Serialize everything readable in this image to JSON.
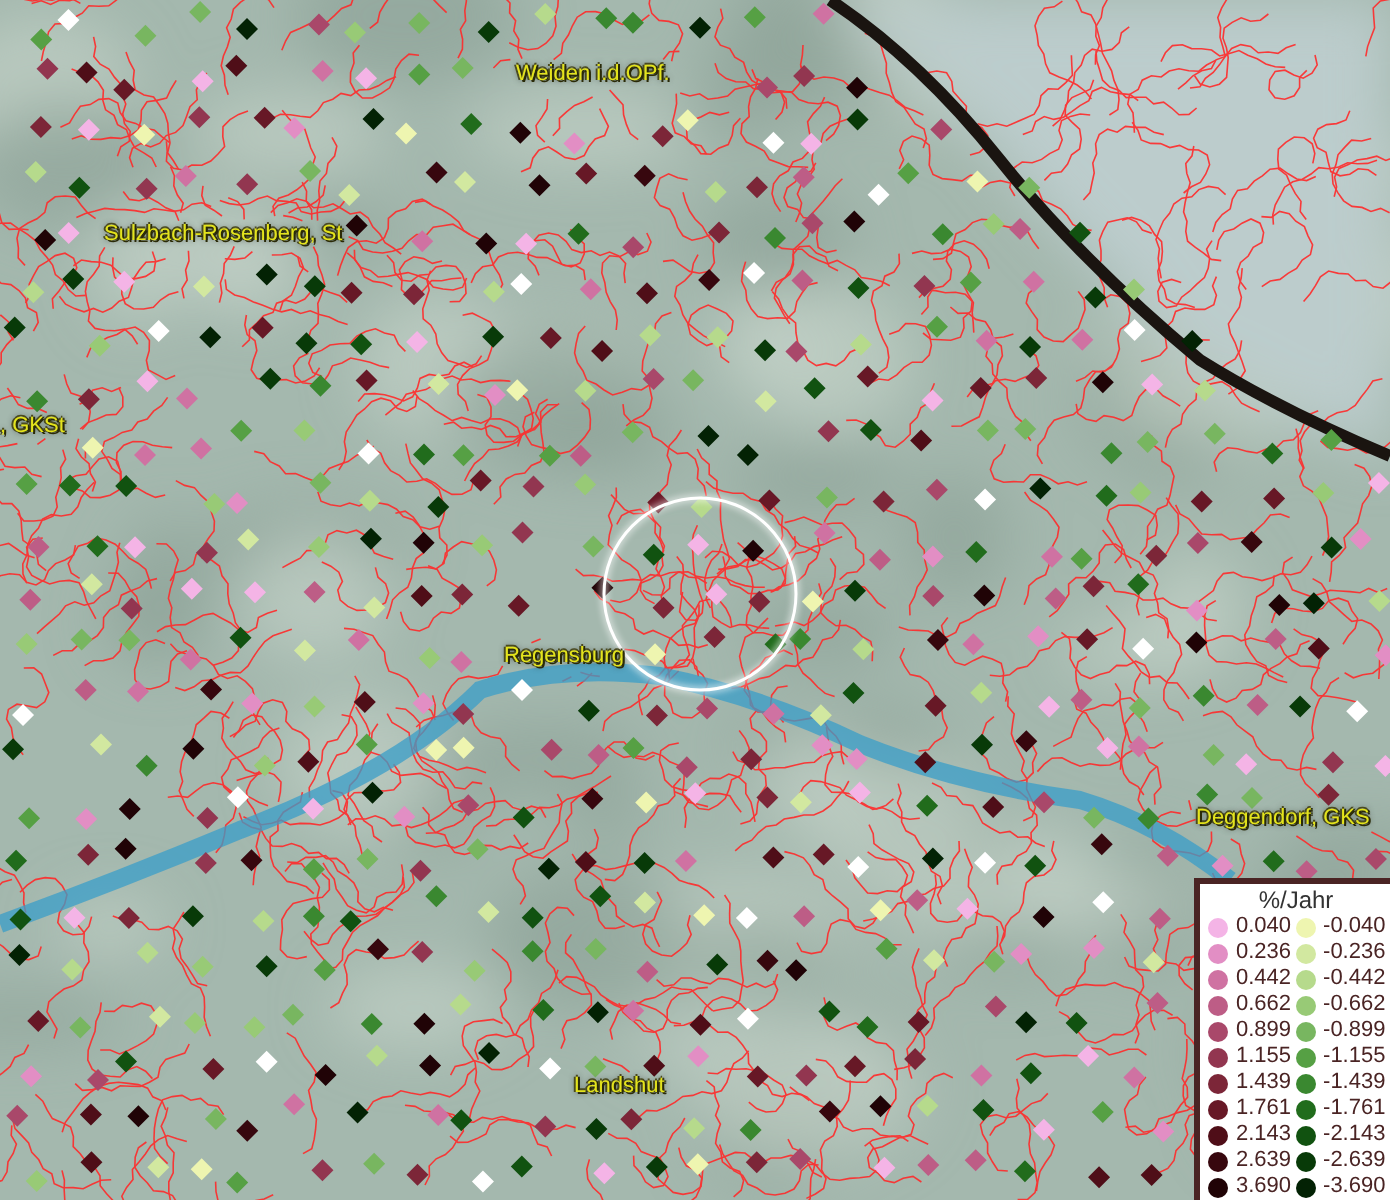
{
  "map": {
    "places": [
      {
        "name": "Weiden i.d.OPf."
      },
      {
        "name": "Sulzbach-Rosenberg, St"
      },
      {
        "name": ", GKSt"
      },
      {
        "name": "Regensburg"
      },
      {
        "name": "Deggendorf, GKS"
      },
      {
        "name": "Landshut"
      }
    ]
  },
  "legend": {
    "title": "%/Jahr",
    "positive": [
      {
        "label": "0.040",
        "color": "#f4b4e6"
      },
      {
        "label": "0.236",
        "color": "#e28ec4"
      },
      {
        "label": "0.442",
        "color": "#cf72a2"
      },
      {
        "label": "0.662",
        "color": "#bd5d86"
      },
      {
        "label": "0.899",
        "color": "#a9486a"
      },
      {
        "label": "1.155",
        "color": "#923650"
      },
      {
        "label": "1.439",
        "color": "#7c2638"
      },
      {
        "label": "1.761",
        "color": "#671826"
      },
      {
        "label": "2.143",
        "color": "#4f0e18"
      },
      {
        "label": "2.639",
        "color": "#37070e"
      },
      {
        "label": "3.690",
        "color": "#200306"
      }
    ],
    "negative": [
      {
        "label": "-0.040",
        "color": "#eef5b0"
      },
      {
        "label": "-0.236",
        "color": "#d2e8a0"
      },
      {
        "label": "-0.442",
        "color": "#b6da8c"
      },
      {
        "label": "-0.662",
        "color": "#98ca76"
      },
      {
        "label": "-0.899",
        "color": "#78b660"
      },
      {
        "label": "-1.155",
        "color": "#56a044"
      },
      {
        "label": "-1.439",
        "color": "#3a8830"
      },
      {
        "label": "-1.761",
        "color": "#216c1c"
      },
      {
        "label": "-2.143",
        "color": "#115210"
      },
      {
        "label": "-2.639",
        "color": "#083a08"
      },
      {
        "label": "-3.690",
        "color": "#032204"
      }
    ]
  }
}
